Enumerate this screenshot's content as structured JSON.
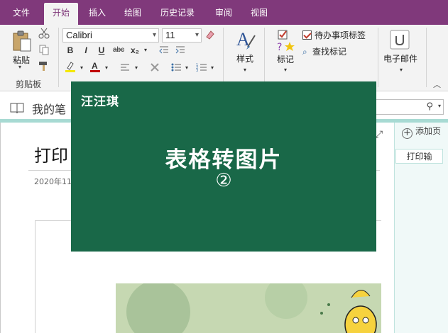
{
  "tabs": [
    {
      "label": "文件",
      "active": false
    },
    {
      "label": "开始",
      "active": true
    },
    {
      "label": "插入",
      "active": false
    },
    {
      "label": "绘图",
      "active": false
    },
    {
      "label": "历史记录",
      "active": false
    },
    {
      "label": "审阅",
      "active": false
    },
    {
      "label": "视图",
      "active": false
    }
  ],
  "ribbon": {
    "clipboard": {
      "paste_label": "粘贴",
      "group_label": "剪贴板"
    },
    "font": {
      "name": "Calibri",
      "size": "11"
    },
    "format_buttons": [
      "B",
      "I",
      "U",
      "abc",
      "x₂"
    ],
    "styles_label": "样式",
    "tags": {
      "tag_label": "标记",
      "todo_label": "待办事项标签",
      "find_label": "查找标记"
    },
    "email_label": "电子邮件"
  },
  "notebook": {
    "title": "我的笔"
  },
  "page": {
    "title": "打印",
    "date": "2020年11"
  },
  "right_pane": {
    "add_page": "添加页",
    "page_tab": "打印输"
  },
  "overlay": {
    "brand": "汪汪琪",
    "title": "表格转图片",
    "subtitle": "②"
  },
  "colors": {
    "tabbar": "#80397b",
    "overlay": "#196848",
    "accent": "#a7dad3"
  }
}
